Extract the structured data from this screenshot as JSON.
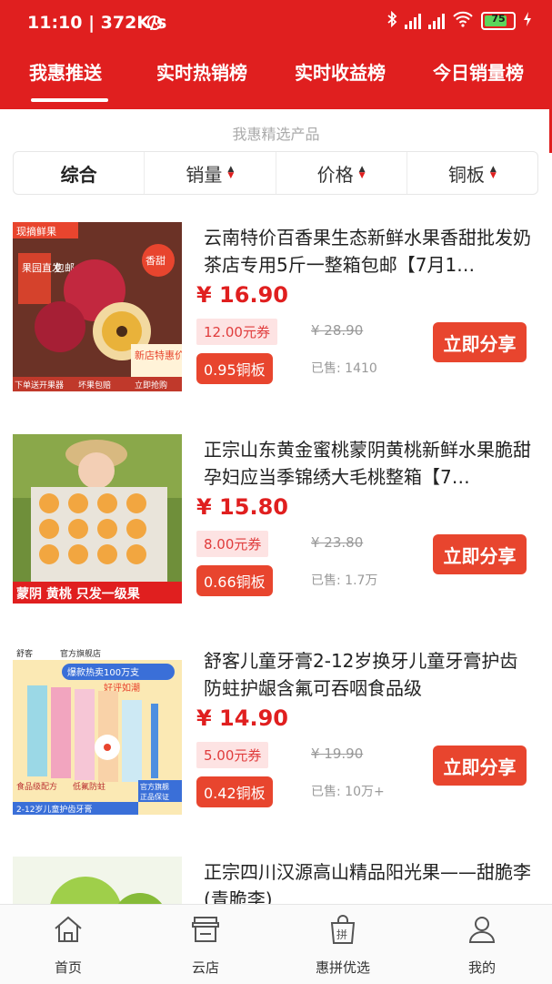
{
  "status_bar": {
    "time": "11:10 | 372K/s",
    "battery": "75",
    "colors": {
      "background": "#e01f1f"
    },
    "icons": [
      "alarm-icon",
      "bluetooth-icon",
      "signal-hd-icon",
      "signal-hd-icon",
      "wifi-icon",
      "battery-icon",
      "charging-icon"
    ]
  },
  "tabs": [
    {
      "label": "我惠推送",
      "active": true
    },
    {
      "label": "实时热销榜",
      "active": false
    },
    {
      "label": "实时收益榜",
      "active": false
    },
    {
      "label": "今日销量榜",
      "active": false
    }
  ],
  "section_title": "我惠精选产品",
  "sort_options": [
    {
      "label": "综合",
      "has_arrows": false
    },
    {
      "label": "销量",
      "has_arrows": true
    },
    {
      "label": "价格",
      "has_arrows": true
    },
    {
      "label": "铜板",
      "has_arrows": true
    }
  ],
  "products": [
    {
      "title": "云南特价百香果生态新鲜水果香甜批发奶茶店专用5斤一整箱包邮【7月1…",
      "price": "¥ 16.90",
      "coupon": "12.00元券",
      "original_price": "¥ 28.90",
      "copper": "0.95铜板",
      "sold": "已售: 1410",
      "share_label": "立即分享",
      "image_labels": [
        "现摘鲜果",
        "果园直发",
        "包邮",
        "香甜",
        "新店特惠价",
        "下单送开果器",
        "坏果包赔",
        "立即抢购"
      ]
    },
    {
      "title": "正宗山东黄金蜜桃蒙阴黄桃新鲜水果脆甜孕妇应当季锦绣大毛桃整箱【7…",
      "price": "¥ 15.80",
      "coupon": "8.00元券",
      "original_price": "¥ 23.80",
      "copper": "0.66铜板",
      "sold": "已售: 1.7万",
      "share_label": "立即分享",
      "image_labels": [
        "蒙阴 黄桃 只发一级果"
      ]
    },
    {
      "title": "舒客儿童牙膏2-12岁换牙儿童牙膏护齿防蛀护龈含氟可吞咽食品级",
      "price": "¥ 14.90",
      "coupon": "5.00元券",
      "original_price": "¥ 19.90",
      "copper": "0.42铜板",
      "sold": "已售: 10万+",
      "share_label": "立即分享",
      "image_labels": [
        "舒客",
        "官方旗舰店",
        "爆款热卖100万支",
        "好评如潮",
        "食品级配方",
        "低氟防蛀",
        "官方旗舰",
        "正品保证",
        "2-12岁儿童护齿牙膏"
      ]
    },
    {
      "title": "正宗四川汉源高山精品阳光果——甜脆李(青脆李)",
      "price": "",
      "coupon": "",
      "original_price": "",
      "copper": "",
      "sold": "",
      "share_label": ""
    }
  ],
  "bottom_nav": [
    {
      "label": "首页",
      "icon": "home-icon"
    },
    {
      "label": "云店",
      "icon": "store-icon"
    },
    {
      "label": "惠拼优选",
      "icon": "shopping-bag-icon"
    },
    {
      "label": "我的",
      "icon": "user-icon"
    }
  ]
}
